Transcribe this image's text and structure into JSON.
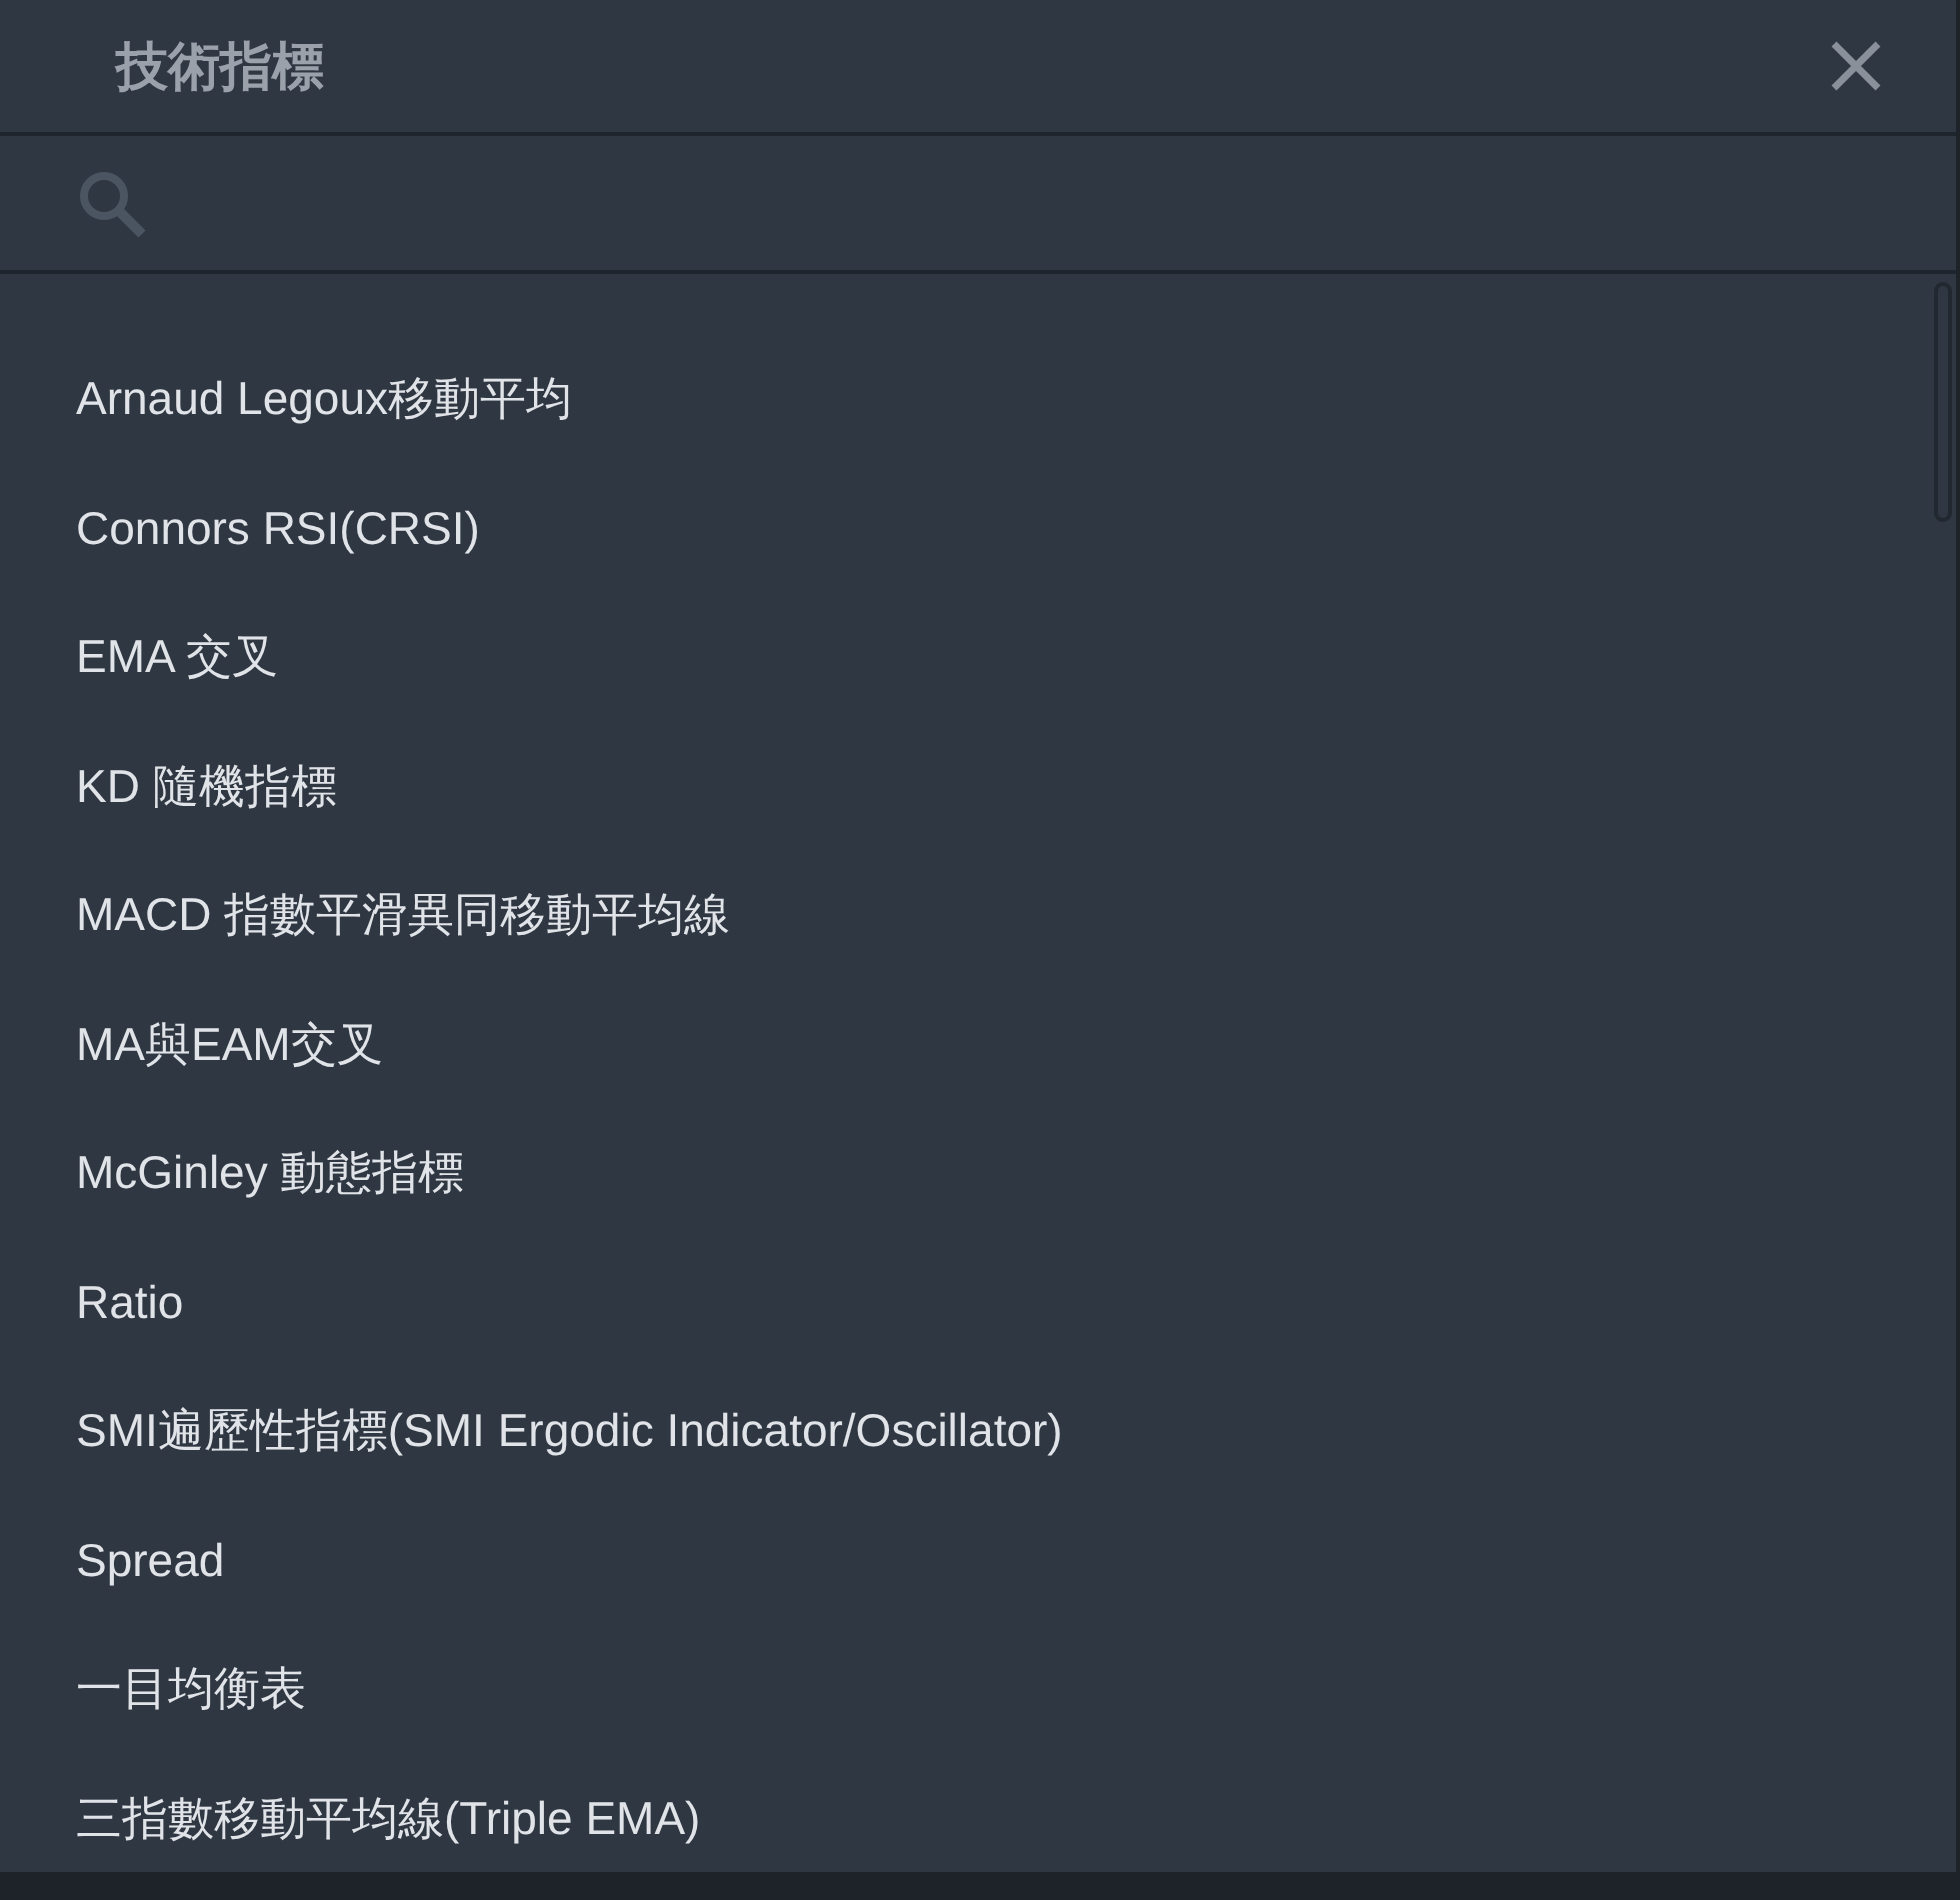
{
  "dialog": {
    "title": "技術指標"
  },
  "indicators": [
    "Arnaud Legoux移動平均",
    "Connors RSI(CRSI)",
    "EMA 交叉",
    "KD 隨機指標",
    "MACD 指數平滑異同移動平均線",
    "MA與EAM交叉",
    "McGinley 動態指標",
    "Ratio",
    "SMI遍歷性指標(SMI Ergodic Indicator/Oscillator)",
    "Spread",
    "一目均衡表",
    "三指數移動平均線(Triple EMA)"
  ]
}
